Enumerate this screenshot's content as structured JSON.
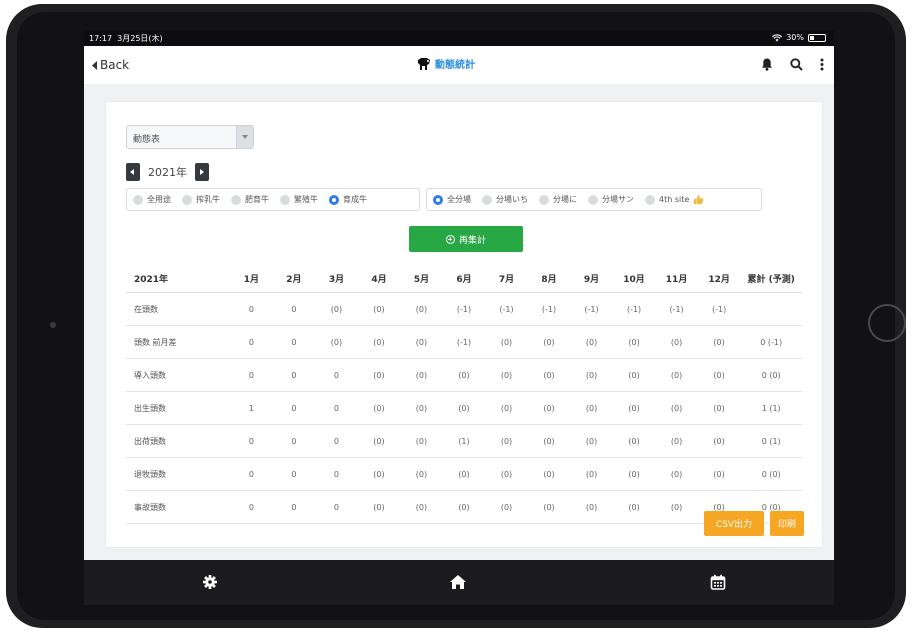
{
  "status_bar": {
    "time": "17:17",
    "date": "3月25日(木)",
    "wifi_icon": "wifi-icon",
    "battery": "30%",
    "battery_level": 0.3
  },
  "nav": {
    "back_label": "Back",
    "title": "動態統計",
    "logo_icon": "cow-logo-icon",
    "icons": [
      "bell-icon",
      "search-icon",
      "more-vertical-icon"
    ]
  },
  "filter": {
    "table_select": "動態表",
    "year": "2021年"
  },
  "usage_options": [
    {
      "label": "全用途",
      "selected": false
    },
    {
      "label": "搾乳牛",
      "selected": false
    },
    {
      "label": "肥育牛",
      "selected": false
    },
    {
      "label": "繁殖牛",
      "selected": false
    },
    {
      "label": "育成牛",
      "selected": true
    }
  ],
  "site_options": [
    {
      "label": "全分場",
      "selected": true
    },
    {
      "label": "分場いち",
      "selected": false
    },
    {
      "label": "分場に",
      "selected": false
    },
    {
      "label": "分場サン",
      "selected": false
    },
    {
      "label": "4th site",
      "selected": false,
      "emoji": "thumbs-up-icon"
    }
  ],
  "recalc_label": "再集計",
  "table": {
    "headers": [
      "2021年",
      "1月",
      "2月",
      "3月",
      "4月",
      "5月",
      "6月",
      "7月",
      "8月",
      "9月",
      "10月",
      "11月",
      "12月",
      "累計 (予測)"
    ],
    "rows": [
      [
        "在頭数",
        "0",
        "0",
        "(0)",
        "(0)",
        "(0)",
        "(-1)",
        "(-1)",
        "(-1)",
        "(-1)",
        "(-1)",
        "(-1)",
        "(-1)",
        ""
      ],
      [
        "頭数 前月差",
        "0",
        "0",
        "(0)",
        "(0)",
        "(0)",
        "(-1)",
        "(0)",
        "(0)",
        "(0)",
        "(0)",
        "(0)",
        "(0)",
        "0 (-1)"
      ],
      [
        "導入頭数",
        "0",
        "0",
        "0",
        "(0)",
        "(0)",
        "(0)",
        "(0)",
        "(0)",
        "(0)",
        "(0)",
        "(0)",
        "(0)",
        "0 (0)"
      ],
      [
        "出生頭数",
        "1",
        "0",
        "0",
        "(0)",
        "(0)",
        "(0)",
        "(0)",
        "(0)",
        "(0)",
        "(0)",
        "(0)",
        "(0)",
        "1 (1)"
      ],
      [
        "出荷頭数",
        "0",
        "0",
        "0",
        "(0)",
        "(0)",
        "(1)",
        "(0)",
        "(0)",
        "(0)",
        "(0)",
        "(0)",
        "(0)",
        "0 (1)"
      ],
      [
        "退牧頭数",
        "0",
        "0",
        "0",
        "(0)",
        "(0)",
        "(0)",
        "(0)",
        "(0)",
        "(0)",
        "(0)",
        "(0)",
        "(0)",
        "0 (0)"
      ],
      [
        "事故頭数",
        "0",
        "0",
        "0",
        "(0)",
        "(0)",
        "(0)",
        "(0)",
        "(0)",
        "(0)",
        "(0)",
        "(0)",
        "(0)",
        "0 (0)"
      ]
    ]
  },
  "actions": {
    "csv_label": "CSV出力",
    "print_label": "印刷"
  },
  "tab_bar": [
    "gear-icon",
    "home-icon",
    "calendar-icon"
  ],
  "colors": {
    "accent_blue": "#2f7de1",
    "recalc_green": "#28a745",
    "action_orange": "#f5a623",
    "dark": "#343a40"
  }
}
